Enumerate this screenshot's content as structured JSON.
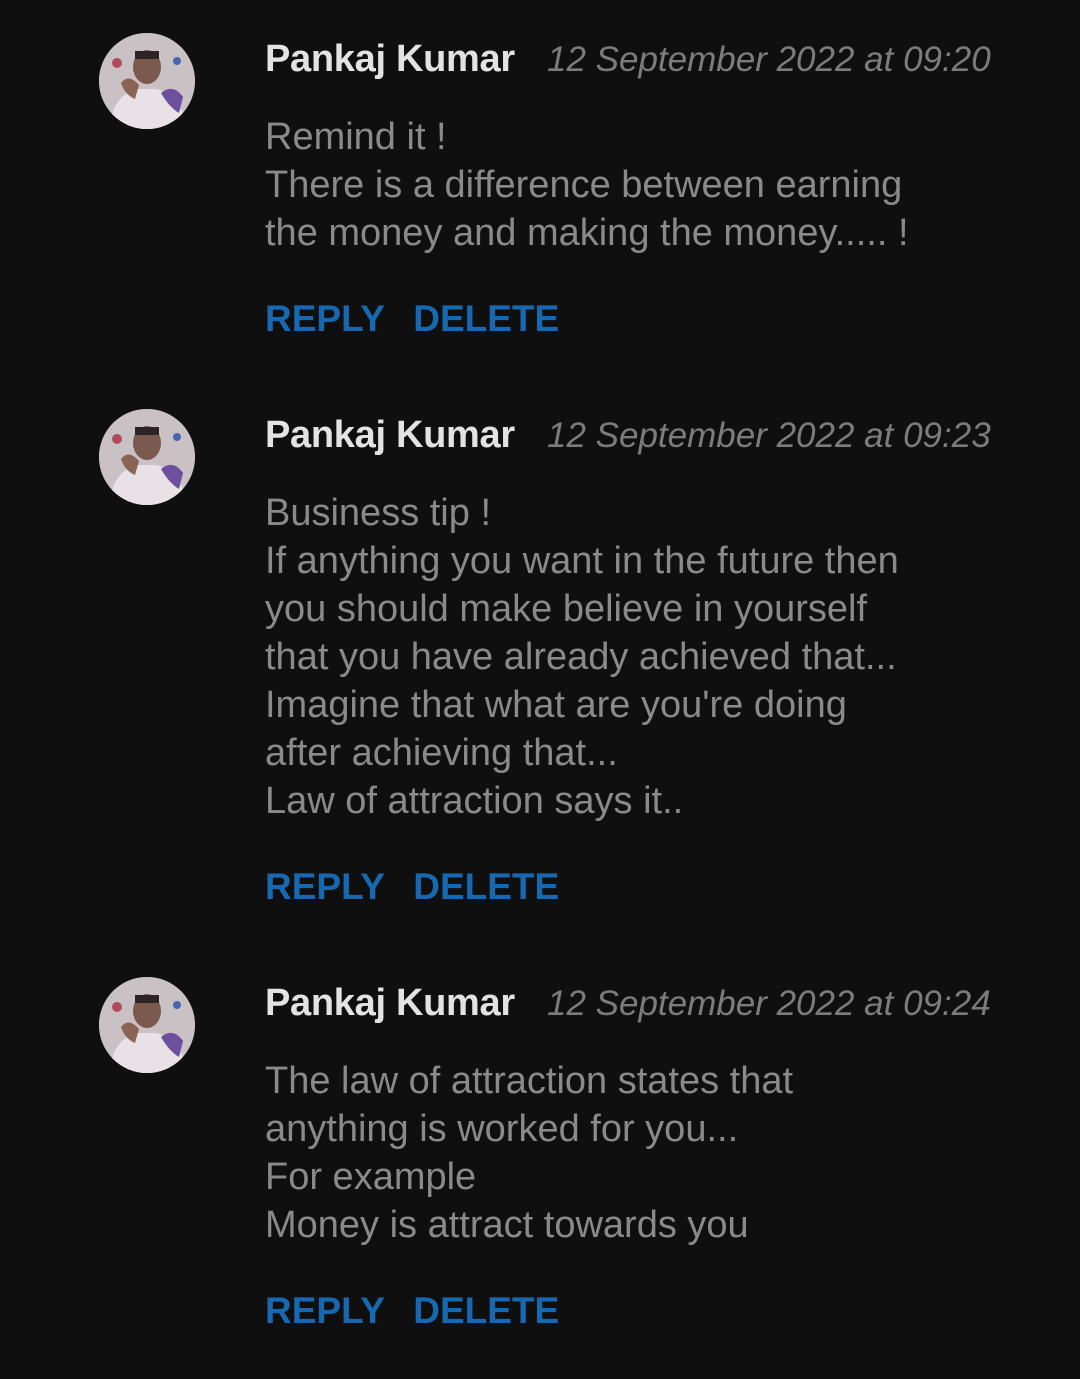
{
  "comments": [
    {
      "author": "Pankaj Kumar",
      "timestamp": "12 September 2022 at 09:20",
      "lines": [
        "Remind it !",
        "There is a difference between earning",
        "the money and making the money..... !"
      ],
      "reply_label": "REPLY",
      "delete_label": "DELETE"
    },
    {
      "author": "Pankaj Kumar",
      "timestamp": "12 September 2022 at 09:23",
      "lines": [
        "Business tip !",
        "If anything you want in the future then",
        "you should make believe in yourself",
        "that you have already achieved that...",
        "Imagine that what are you're doing",
        "after achieving that...",
        "Law of attraction says it.."
      ],
      "reply_label": "REPLY",
      "delete_label": "DELETE"
    },
    {
      "author": "Pankaj Kumar",
      "timestamp": "12 September 2022 at 09:24",
      "lines": [
        "The law of attraction states that",
        "anything is worked for you...",
        "For example",
        "Money is attract towards you"
      ],
      "reply_label": "REPLY",
      "delete_label": "DELETE"
    }
  ],
  "colors": {
    "background": "#0f0f0f",
    "author": "#e3e3e3",
    "timestamp": "#7c7c7c",
    "body": "#8a8a8a",
    "action": "#1669b0"
  },
  "icons": {
    "avatar": "user-avatar-photo"
  }
}
